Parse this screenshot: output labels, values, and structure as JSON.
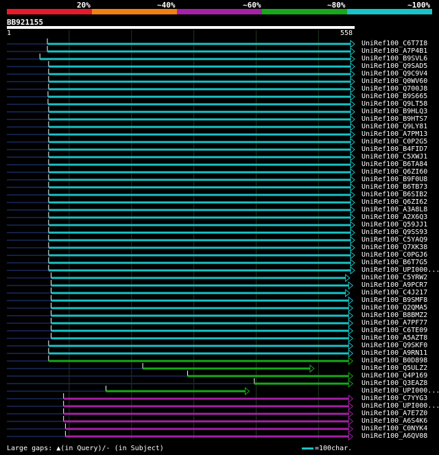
{
  "legend": {
    "colors": [
      "#e31b2d",
      "#f07f16",
      "#a322a6",
      "#17a81b",
      "#19c3c6"
    ],
    "labels": [
      "20%",
      "~40%",
      "~60%",
      "~80%",
      "~100%"
    ]
  },
  "query": {
    "id": "BB921155",
    "start": "1",
    "end": "558",
    "length": 558
  },
  "hits": [
    {
      "name": "UniRef100_C6T7I8",
      "start": 65,
      "end": 558,
      "color": "#19c3c6"
    },
    {
      "name": "UniRef100_A7P4B1",
      "start": 65,
      "end": 558,
      "color": "#19c3c6"
    },
    {
      "name": "UniRef100_B9SVL6",
      "start": 53,
      "end": 558,
      "color": "#19c3c6"
    },
    {
      "name": "UniRef100_Q9SAD5",
      "start": 67,
      "end": 558,
      "color": "#19c3c6"
    },
    {
      "name": "UniRef100_Q9C9V4",
      "start": 67,
      "end": 558,
      "color": "#19c3c6"
    },
    {
      "name": "UniRef100_Q0WV60",
      "start": 67,
      "end": 558,
      "color": "#19c3c6"
    },
    {
      "name": "UniRef100_Q700J8",
      "start": 67,
      "end": 558,
      "color": "#19c3c6"
    },
    {
      "name": "UniRef100_B9S665",
      "start": 66,
      "end": 558,
      "color": "#19c3c6"
    },
    {
      "name": "UniRef100_Q9LT58",
      "start": 66,
      "end": 558,
      "color": "#19c3c6"
    },
    {
      "name": "UniRef100_B9HLQ3",
      "start": 67,
      "end": 558,
      "color": "#19c3c6"
    },
    {
      "name": "UniRef100_B9HTS7",
      "start": 67,
      "end": 558,
      "color": "#19c3c6"
    },
    {
      "name": "UniRef100_Q9LY81",
      "start": 67,
      "end": 558,
      "color": "#19c3c6"
    },
    {
      "name": "UniRef100_A7PM13",
      "start": 67,
      "end": 558,
      "color": "#19c3c6"
    },
    {
      "name": "UniRef100_C0P2G5",
      "start": 67,
      "end": 558,
      "color": "#19c3c6"
    },
    {
      "name": "UniRef100_B4FID7",
      "start": 67,
      "end": 558,
      "color": "#19c3c6"
    },
    {
      "name": "UniRef100_C5XWJ1",
      "start": 67,
      "end": 558,
      "color": "#19c3c6"
    },
    {
      "name": "UniRef100_B6TA84",
      "start": 67,
      "end": 558,
      "color": "#19c3c6"
    },
    {
      "name": "UniRef100_Q6ZI60",
      "start": 67,
      "end": 558,
      "color": "#19c3c6"
    },
    {
      "name": "UniRef100_B9F0U8",
      "start": 67,
      "end": 558,
      "color": "#19c3c6"
    },
    {
      "name": "UniRef100_B6TB73",
      "start": 67,
      "end": 558,
      "color": "#19c3c6"
    },
    {
      "name": "UniRef100_B6SIB2",
      "start": 67,
      "end": 558,
      "color": "#19c3c6"
    },
    {
      "name": "UniRef100_Q6ZI62",
      "start": 67,
      "end": 558,
      "color": "#19c3c6"
    },
    {
      "name": "UniRef100_A3A8L8",
      "start": 67,
      "end": 558,
      "color": "#19c3c6"
    },
    {
      "name": "UniRef100_A2X6Q3",
      "start": 67,
      "end": 558,
      "color": "#19c3c6"
    },
    {
      "name": "UniRef100_Q59JJ1",
      "start": 67,
      "end": 558,
      "color": "#19c3c6"
    },
    {
      "name": "UniRef100_Q9SS93",
      "start": 67,
      "end": 558,
      "color": "#19c3c6"
    },
    {
      "name": "UniRef100_C5YAQ9",
      "start": 67,
      "end": 558,
      "color": "#19c3c6"
    },
    {
      "name": "UniRef100_Q7XK38",
      "start": 67,
      "end": 558,
      "color": "#19c3c6"
    },
    {
      "name": "UniRef100_C0PGJ6",
      "start": 67,
      "end": 558,
      "color": "#19c3c6"
    },
    {
      "name": "UniRef100_B6T7G5",
      "start": 67,
      "end": 558,
      "color": "#19c3c6"
    },
    {
      "name": "UniRef100_UPI000...",
      "start": 67,
      "end": 558,
      "color": "#19c3c6"
    },
    {
      "name": "UniRef100_C5YRW2",
      "start": 71,
      "end": 550,
      "color": "#19c3c6"
    },
    {
      "name": "UniRef100_A9PCR7",
      "start": 71,
      "end": 555,
      "color": "#19c3c6"
    },
    {
      "name": "UniRef100_C4J217",
      "start": 71,
      "end": 550,
      "color": "#19c3c6"
    },
    {
      "name": "UniRef100_B9SMF8",
      "start": 71,
      "end": 555,
      "color": "#19c3c6"
    },
    {
      "name": "UniRef100_Q2QMA5",
      "start": 71,
      "end": 555,
      "color": "#19c3c6"
    },
    {
      "name": "UniRef100_B8BMZ2",
      "start": 71,
      "end": 555,
      "color": "#19c3c6"
    },
    {
      "name": "UniRef100_A7PF77",
      "start": 71,
      "end": 555,
      "color": "#19c3c6"
    },
    {
      "name": "UniRef100_C6TE09",
      "start": 71,
      "end": 555,
      "color": "#19c3c6"
    },
    {
      "name": "UniRef100_A5AZT8",
      "start": 71,
      "end": 555,
      "color": "#19c3c6"
    },
    {
      "name": "UniRef100_Q9SKF0",
      "start": 67,
      "end": 555,
      "color": "#19c3c6"
    },
    {
      "name": "UniRef100_A9RN11",
      "start": 67,
      "end": 555,
      "color": "#19c3c6"
    },
    {
      "name": "UniRef100_B0D898",
      "start": 67,
      "end": 555,
      "color": "#17a81b"
    },
    {
      "name": "UniRef100_Q5ULZ2",
      "start": 218,
      "end": 493,
      "color": "#17a81b"
    },
    {
      "name": "UniRef100_Q4P169",
      "start": 290,
      "end": 555,
      "color": "#17a81b"
    },
    {
      "name": "UniRef100_Q3EAZ8",
      "start": 397,
      "end": 555,
      "color": "#17a81b"
    },
    {
      "name": "UniRef100_UPI000...",
      "start": 159,
      "end": 389,
      "color": "#17a81b"
    },
    {
      "name": "UniRef100_C7YYG3",
      "start": 91,
      "end": 555,
      "color": "#a322a6"
    },
    {
      "name": "UniRef100_UPI000...",
      "start": 91,
      "end": 555,
      "color": "#a322a6"
    },
    {
      "name": "UniRef100_A7E7Z0",
      "start": 91,
      "end": 555,
      "color": "#a322a6"
    },
    {
      "name": "UniRef100_A6S4K6",
      "start": 91,
      "end": 555,
      "color": "#a322a6"
    },
    {
      "name": "UniRef100_C0NYK4",
      "start": 94,
      "end": 555,
      "color": "#a322a6"
    },
    {
      "name": "UniRef100_A6QV08",
      "start": 94,
      "end": 555,
      "color": "#a322a6"
    }
  ],
  "footer": {
    "gaps_text": "Large gaps:",
    "query_gap_symbol": "▲",
    "query_gap_text": "(in Query)/",
    "subject_gap_symbol": "-",
    "subject_gap_text": " (in Subject)",
    "scale_text": "=100char."
  }
}
